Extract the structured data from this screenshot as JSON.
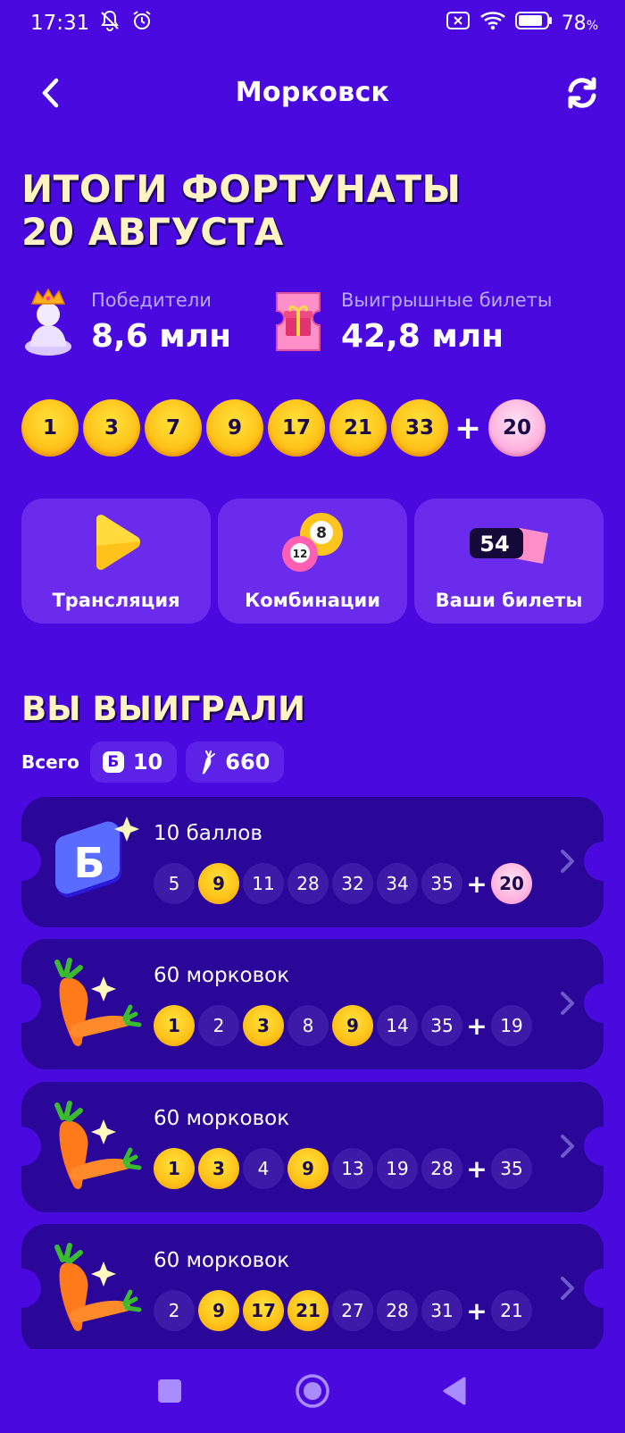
{
  "status_bar": {
    "time": "17:31",
    "battery_percent": "78",
    "icons": [
      "bell-off-icon",
      "alarm-icon",
      "sim-off-icon",
      "wifi-icon",
      "battery-icon"
    ]
  },
  "header": {
    "title": "Морковск",
    "back_icon": "chevron-left-icon",
    "refresh_icon": "refresh-icon"
  },
  "headline": {
    "line1": "ИТОГИ ФОРТУНАТЫ",
    "line2": "20 АВГУСТА"
  },
  "stats": {
    "winners": {
      "label": "Победители",
      "value": "8,6 млн",
      "icon": "crown-person-icon"
    },
    "winning_tickets": {
      "label": "Выигрышные билеты",
      "value": "42,8 млн",
      "icon": "gift-ticket-icon"
    }
  },
  "draw": {
    "numbers": [
      "1",
      "3",
      "7",
      "9",
      "17",
      "21",
      "33"
    ],
    "plus": "+",
    "bonus": "20"
  },
  "actions": [
    {
      "label": "Трансляция",
      "icon": "play-icon"
    },
    {
      "label": "Комбинации",
      "icon": "lottery-balls-icon"
    },
    {
      "label": "Ваши билеты",
      "icon": "tickets-count-icon",
      "badge": "54"
    }
  ],
  "won": {
    "title": "ВЫ ВЫИГРАЛИ",
    "total_label": "Всего",
    "points_badge": "Б",
    "points_total": "10",
    "carrots_total": "660"
  },
  "tickets": [
    {
      "title": "10 баллов",
      "icon": "points-b-icon",
      "numbers": [
        {
          "n": "5",
          "hit": false
        },
        {
          "n": "9",
          "hit": true
        },
        {
          "n": "11",
          "hit": false
        },
        {
          "n": "28",
          "hit": false
        },
        {
          "n": "32",
          "hit": false
        },
        {
          "n": "34",
          "hit": false
        },
        {
          "n": "35",
          "hit": false
        }
      ],
      "bonus": {
        "n": "20",
        "hit": true
      }
    },
    {
      "title": "60 морковок",
      "icon": "carrots-icon",
      "numbers": [
        {
          "n": "1",
          "hit": true
        },
        {
          "n": "2",
          "hit": false
        },
        {
          "n": "3",
          "hit": true
        },
        {
          "n": "8",
          "hit": false
        },
        {
          "n": "9",
          "hit": true
        },
        {
          "n": "14",
          "hit": false
        },
        {
          "n": "35",
          "hit": false
        }
      ],
      "bonus": {
        "n": "19",
        "hit": false
      }
    },
    {
      "title": "60 морковок",
      "icon": "carrots-icon",
      "numbers": [
        {
          "n": "1",
          "hit": true
        },
        {
          "n": "3",
          "hit": true
        },
        {
          "n": "4",
          "hit": false
        },
        {
          "n": "9",
          "hit": true
        },
        {
          "n": "13",
          "hit": false
        },
        {
          "n": "19",
          "hit": false
        },
        {
          "n": "28",
          "hit": false
        }
      ],
      "bonus": {
        "n": "35",
        "hit": false
      }
    },
    {
      "title": "60 морковок",
      "icon": "carrots-icon",
      "numbers": [
        {
          "n": "2",
          "hit": false
        },
        {
          "n": "9",
          "hit": true
        },
        {
          "n": "17",
          "hit": true
        },
        {
          "n": "21",
          "hit": true
        },
        {
          "n": "27",
          "hit": false
        },
        {
          "n": "28",
          "hit": false
        },
        {
          "n": "31",
          "hit": false
        }
      ],
      "bonus": {
        "n": "21",
        "hit": false
      }
    }
  ],
  "nav": {
    "recents_icon": "square-icon",
    "home_icon": "circle-home-icon",
    "back_icon": "triangle-back-icon"
  },
  "colors": {
    "background": "#4a0adf",
    "card": "#6a2bec",
    "ticket": "#2a0699",
    "headline": "#fff3c4",
    "gold_ball": "#ffc51c",
    "pink_ball": "#ffb4e0"
  }
}
